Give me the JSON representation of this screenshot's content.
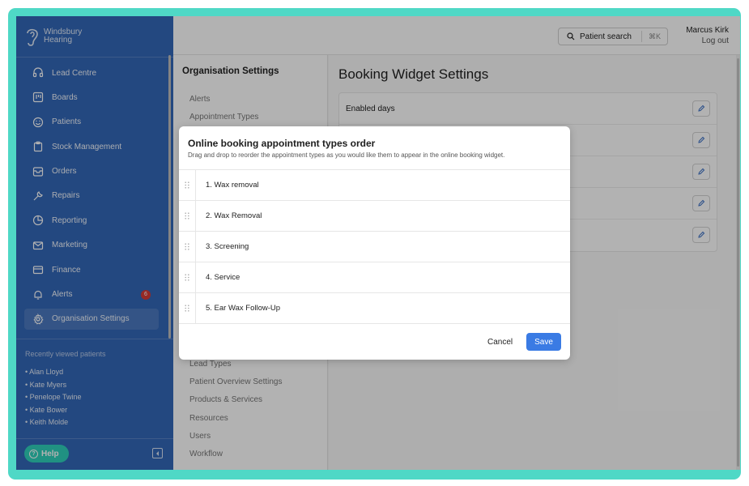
{
  "brand": {
    "line1": "Windsbury",
    "line2": "Hearing"
  },
  "sidebar": {
    "items": [
      {
        "label": "Lead Centre",
        "icon": "headset-icon"
      },
      {
        "label": "Boards",
        "icon": "board-icon"
      },
      {
        "label": "Patients",
        "icon": "smile-icon"
      },
      {
        "label": "Stock Management",
        "icon": "clipboard-icon"
      },
      {
        "label": "Orders",
        "icon": "inbox-icon"
      },
      {
        "label": "Repairs",
        "icon": "wrench-icon"
      },
      {
        "label": "Reporting",
        "icon": "pie-chart-icon"
      },
      {
        "label": "Marketing",
        "icon": "mail-icon"
      },
      {
        "label": "Finance",
        "icon": "credit-card-icon"
      },
      {
        "label": "Alerts",
        "icon": "bell-icon",
        "badge": "6"
      },
      {
        "label": "Organisation Settings",
        "icon": "gear-icon",
        "active": true
      }
    ],
    "recent_title": "Recently viewed patients",
    "recent": [
      "• Alan Lloyd",
      "• Kate Myers",
      "• Penelope Twine",
      "• Kate Bower",
      "• Keith Molde"
    ],
    "help_label": "Help"
  },
  "topbar": {
    "search_label": "Patient search",
    "search_shortcut": "⌘K",
    "user_name": "Marcus Kirk",
    "logout_label": "Log out"
  },
  "settings": {
    "title": "Organisation Settings",
    "items_top": [
      "Alerts",
      "Appointment Types"
    ],
    "items_bottom": [
      "Lead Types",
      "Patient Overview Settings",
      "Products & Services",
      "Resources",
      "Users",
      "Workflow"
    ]
  },
  "main": {
    "title": "Booking Widget Settings",
    "rows": [
      "Enabled days",
      "",
      "",
      "",
      ""
    ]
  },
  "modal": {
    "title": "Online booking appointment types order",
    "subtitle": "Drag and drop to reorder the appointment types as you would like them to appear in the online booking widget.",
    "items": [
      "1. Wax removal",
      "2. Wax Removal",
      "3. Screening",
      "4. Service",
      "5. Ear Wax Follow-Up"
    ],
    "cancel_label": "Cancel",
    "save_label": "Save"
  },
  "colors": {
    "sidebar": "#3367b8",
    "accent": "#3a7be4",
    "frame": "#4fd8c6",
    "badge": "#d83b36"
  }
}
